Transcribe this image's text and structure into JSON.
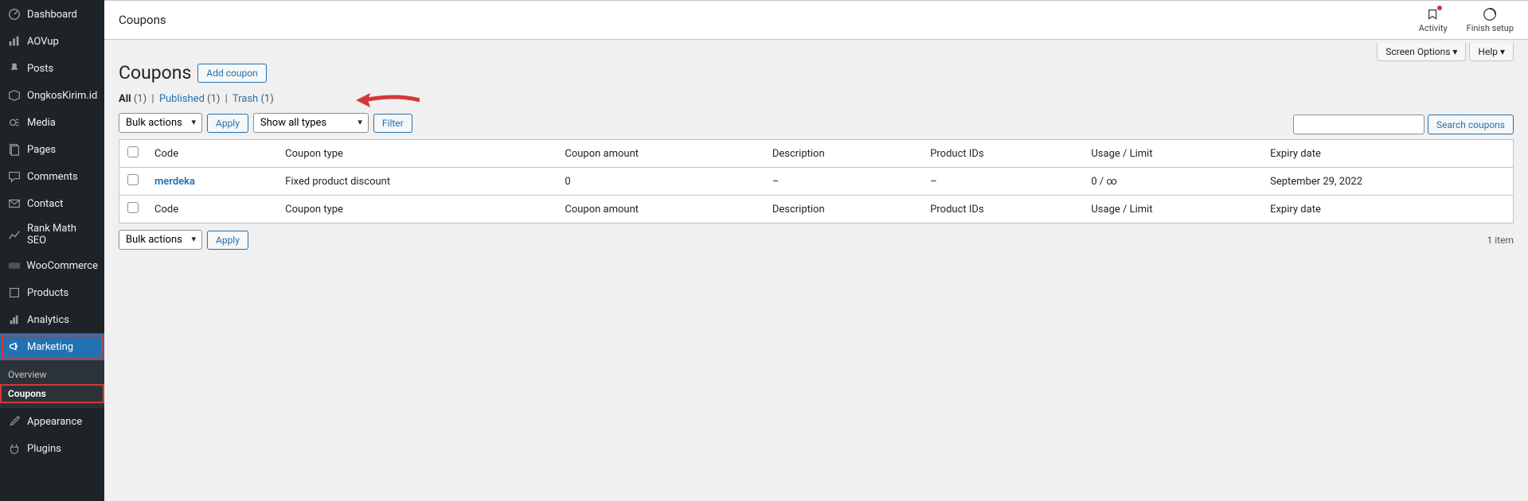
{
  "sidebar": {
    "items": [
      {
        "label": "Dashboard"
      },
      {
        "label": "AOVup"
      },
      {
        "label": "Posts"
      },
      {
        "label": "OngkosKirim.id"
      },
      {
        "label": "Media"
      },
      {
        "label": "Pages"
      },
      {
        "label": "Comments"
      },
      {
        "label": "Contact"
      },
      {
        "label": "Rank Math SEO"
      },
      {
        "label": "WooCommerce"
      },
      {
        "label": "Products"
      },
      {
        "label": "Analytics"
      },
      {
        "label": "Marketing"
      },
      {
        "label": "Appearance"
      },
      {
        "label": "Plugins"
      }
    ],
    "sub": {
      "overview": "Overview",
      "coupons": "Coupons"
    }
  },
  "topbar": {
    "title": "Coupons",
    "activity": "Activity",
    "finish": "Finish setup"
  },
  "screen_tabs": {
    "screen_options": "Screen Options ▾",
    "help": "Help ▾"
  },
  "page": {
    "heading": "Coupons",
    "add_btn": "Add coupon"
  },
  "filters": {
    "all_label": "All",
    "all_count": "(1)",
    "published_label": "Published",
    "published_count": "(1)",
    "trash_label": "Trash",
    "trash_count": "(1)",
    "sep": "|"
  },
  "search": {
    "btn": "Search coupons"
  },
  "toolbar": {
    "bulk": "Bulk actions",
    "apply": "Apply",
    "types": "Show all types",
    "filter": "Filter",
    "count": "1 item"
  },
  "columns": {
    "code": "Code",
    "type": "Coupon type",
    "amount": "Coupon amount",
    "desc": "Description",
    "prod": "Product IDs",
    "usage": "Usage / Limit",
    "expiry": "Expiry date"
  },
  "rows": [
    {
      "code": "merdeka",
      "type": "Fixed product discount",
      "amount": "0",
      "desc": "–",
      "prod": "–",
      "usage": "0 / ∞",
      "expiry": "September 29, 2022"
    }
  ]
}
